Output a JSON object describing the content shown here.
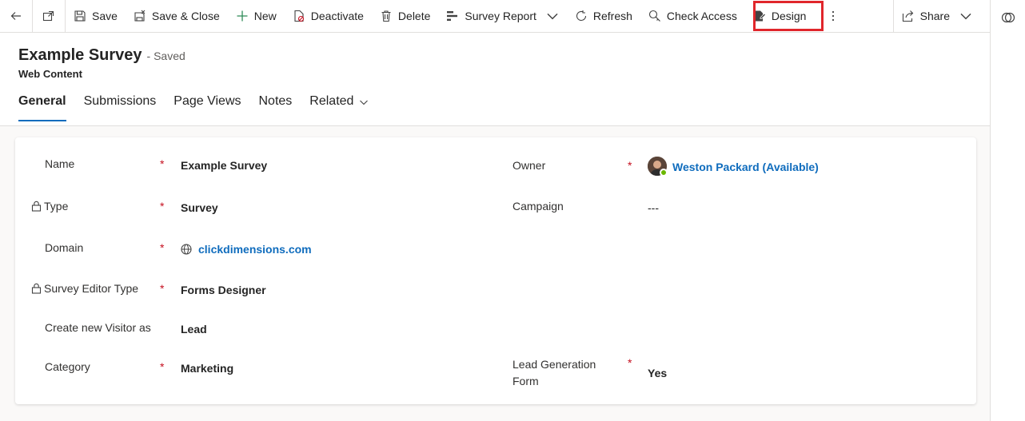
{
  "commandbar": {
    "save": "Save",
    "save_close": "Save & Close",
    "new": "New",
    "deactivate": "Deactivate",
    "delete": "Delete",
    "survey_report": "Survey Report",
    "refresh": "Refresh",
    "check_access": "Check Access",
    "design": "Design",
    "share": "Share"
  },
  "header": {
    "title": "Example Survey",
    "status": "- Saved",
    "entity": "Web Content"
  },
  "tabs": [
    "General",
    "Submissions",
    "Page Views",
    "Notes",
    "Related"
  ],
  "form": {
    "name_label": "Name",
    "name_value": "Example Survey",
    "type_label": "Type",
    "type_value": "Survey",
    "domain_label": "Domain",
    "domain_value": "clickdimensions.com",
    "editor_label": "Survey Editor Type",
    "editor_value": "Forms Designer",
    "visitor_label": "Create new Visitor as",
    "visitor_value": "Lead",
    "category_label": "Category",
    "category_value": "Marketing",
    "owner_label": "Owner",
    "owner_value": "Weston Packard (Available)",
    "campaign_label": "Campaign",
    "campaign_value": "---",
    "leadgen_label_1": "Lead Generation",
    "leadgen_label_2": "Form",
    "leadgen_value": "Yes",
    "required_mark": "*"
  },
  "colors": {
    "accent": "#0f6cbd",
    "required": "#c50f1f",
    "highlight": "#e0262b",
    "presence": "#6bb700"
  }
}
